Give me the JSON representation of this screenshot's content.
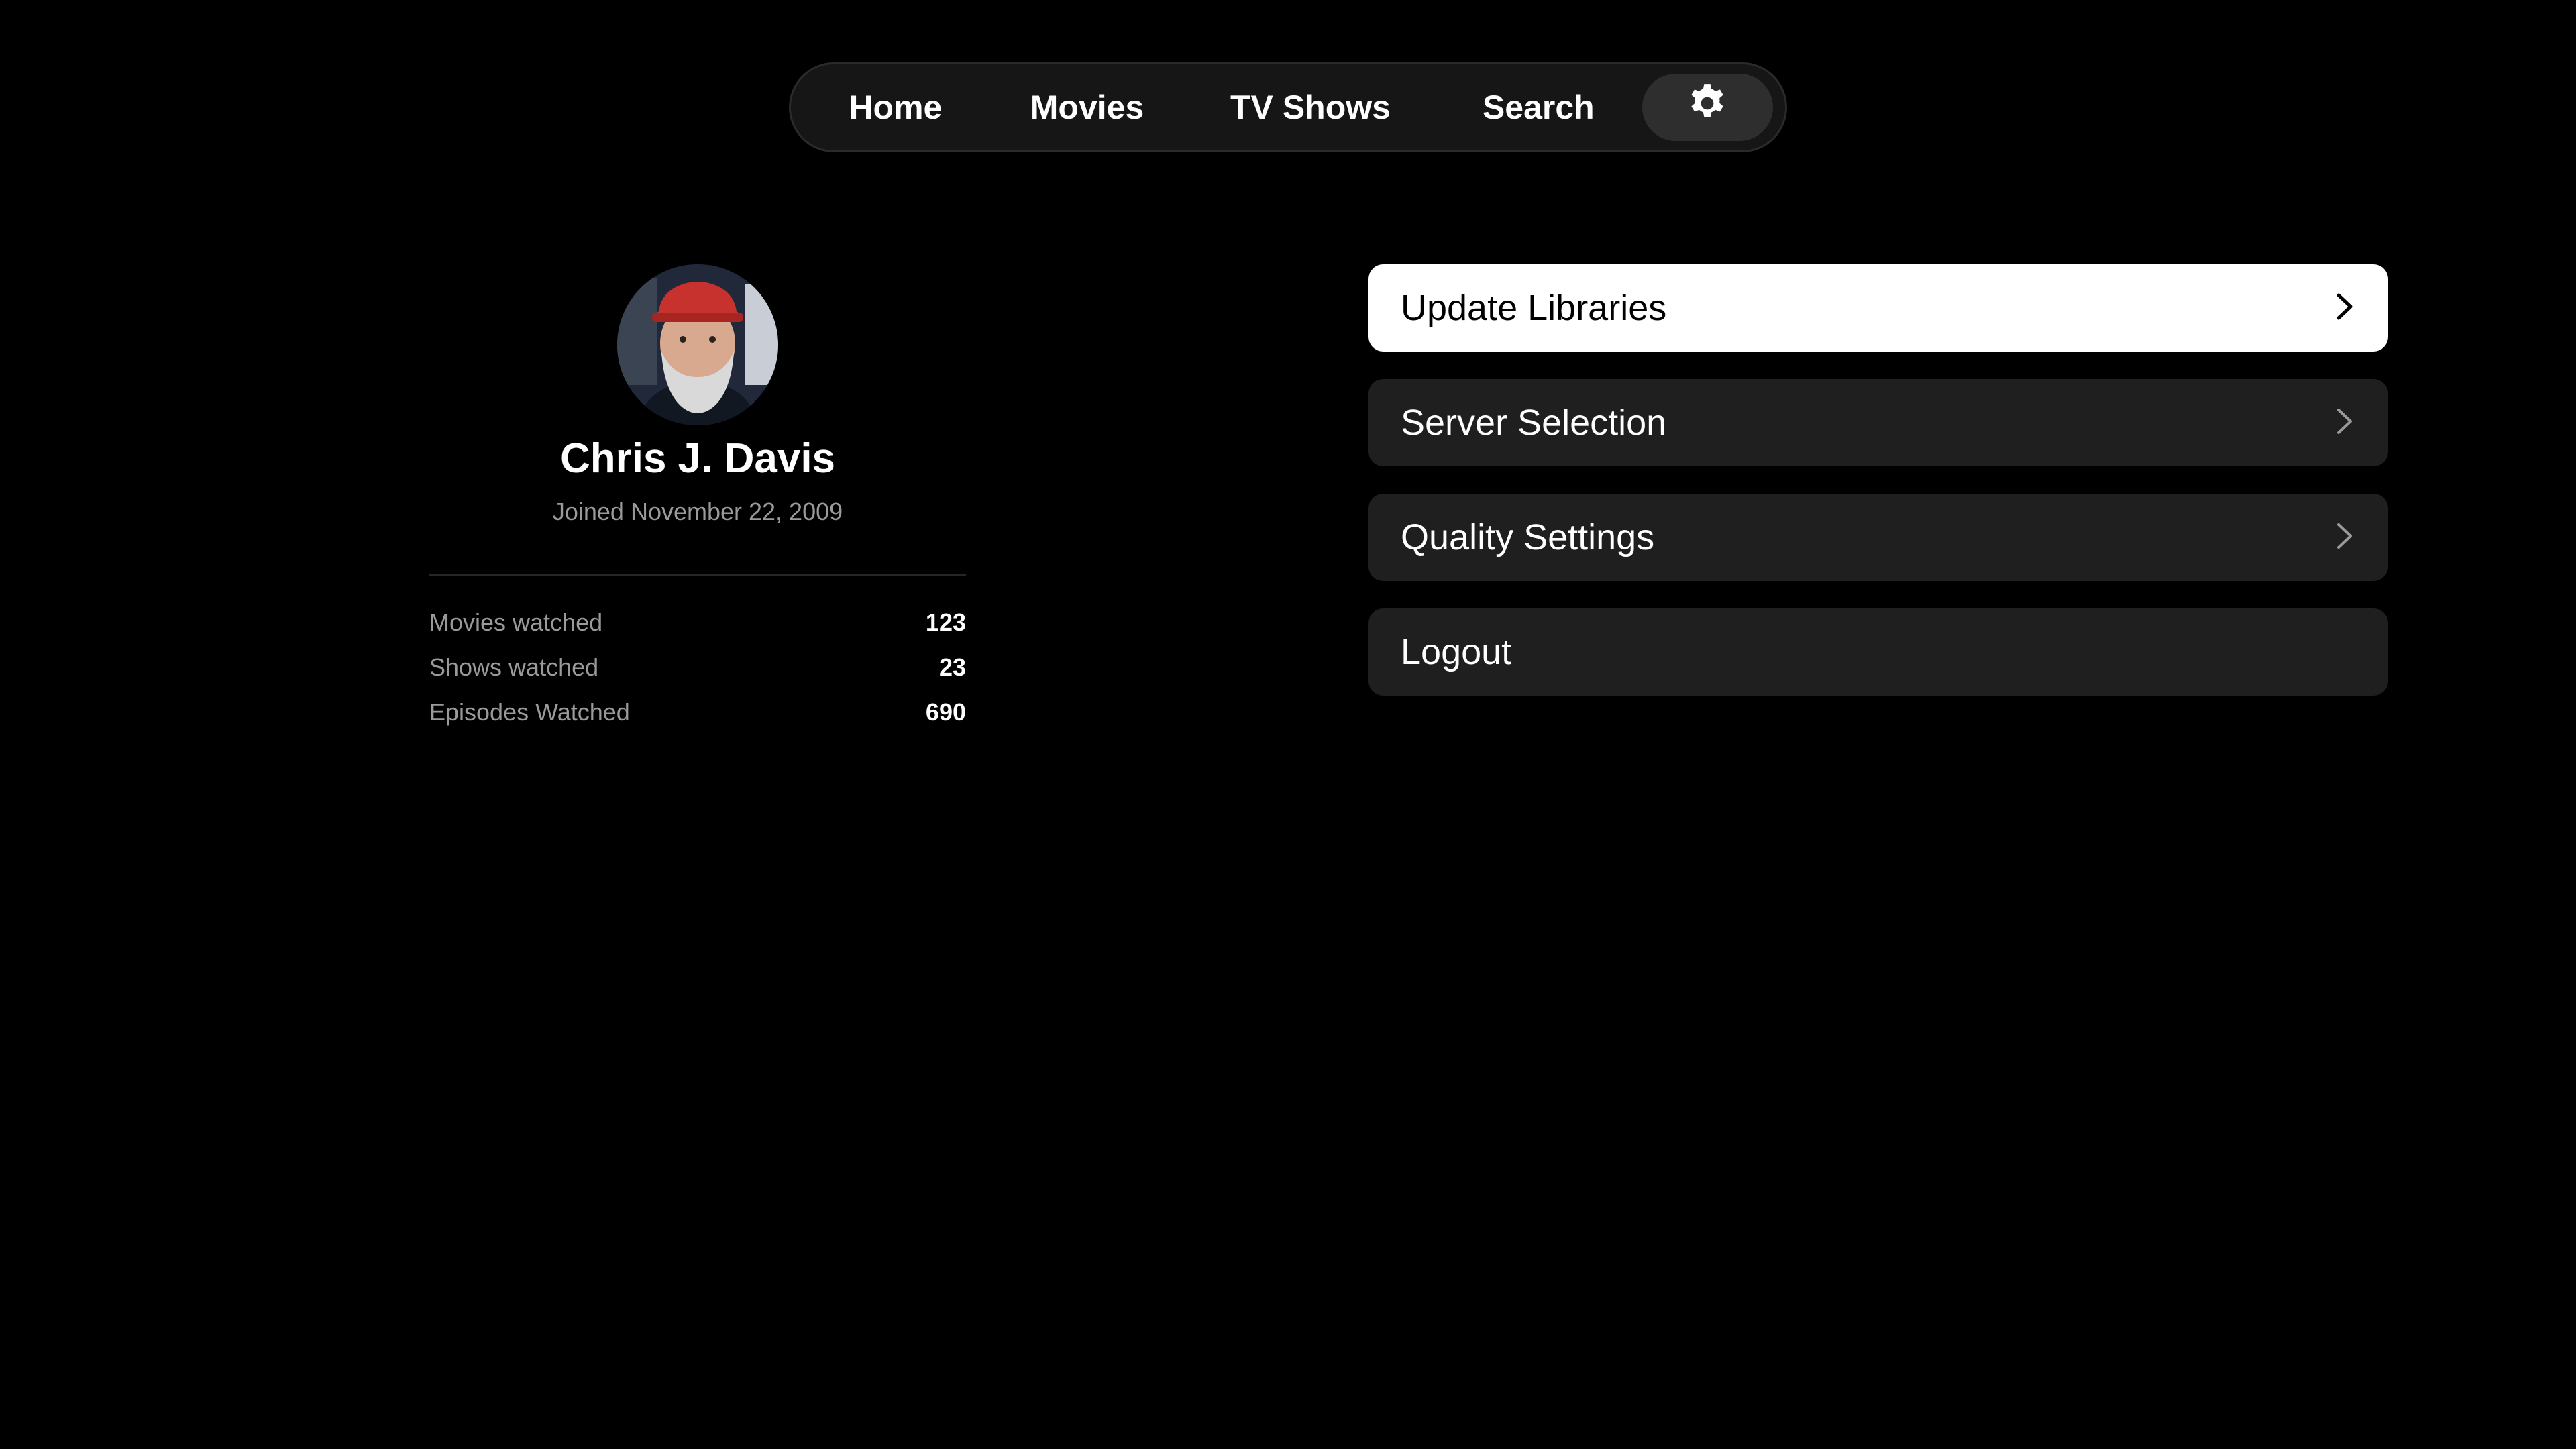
{
  "nav": {
    "items": [
      {
        "label": "Home"
      },
      {
        "label": "Movies"
      },
      {
        "label": "TV Shows"
      },
      {
        "label": "Search"
      }
    ],
    "settings_icon": "gear-icon",
    "selected": "settings"
  },
  "profile": {
    "avatar_icon": "avatar",
    "name": "Chris J. Davis",
    "joined": "Joined November 22, 2009",
    "stats": [
      {
        "label": "Movies watched",
        "value": "123"
      },
      {
        "label": "Shows watched",
        "value": "23"
      },
      {
        "label": "Episodes Watched",
        "value": "690"
      }
    ]
  },
  "menu": {
    "items": [
      {
        "label": "Update Libraries",
        "icon": "chevron-right-icon",
        "focused": true
      },
      {
        "label": "Server Selection",
        "icon": "chevron-right-icon"
      },
      {
        "label": "Quality Settings",
        "icon": "chevron-right-icon"
      },
      {
        "label": "Logout"
      }
    ]
  },
  "colors": {
    "background": "#000000",
    "nav_background": "#161616",
    "nav_selected": "#2e2e2e",
    "menu_item": "#1f1f1f",
    "menu_item_focused": "#ffffff",
    "secondary_text": "#9a9a9a"
  }
}
